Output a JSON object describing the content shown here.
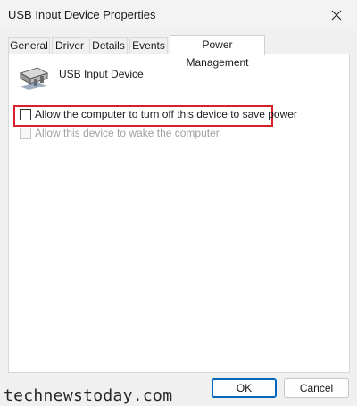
{
  "window": {
    "title": "USB Input Device Properties"
  },
  "tabs": [
    {
      "label": "General"
    },
    {
      "label": "Driver"
    },
    {
      "label": "Details"
    },
    {
      "label": "Events"
    },
    {
      "label": "Power Management",
      "active": true
    }
  ],
  "device": {
    "name": "USB Input Device",
    "icon": "usb-plug-icon"
  },
  "options": [
    {
      "label": "Allow the computer to turn off this device to save power",
      "checked": false,
      "enabled": true,
      "highlighted": true
    },
    {
      "label": "Allow this device to wake the computer",
      "checked": false,
      "enabled": false
    }
  ],
  "buttons": {
    "ok": "OK",
    "cancel": "Cancel"
  },
  "watermark": "technewstoday.com",
  "colors": {
    "highlight_border": "#d9202a",
    "default_button_border": "#0067c0",
    "disabled_text": "#a0a0a0"
  }
}
